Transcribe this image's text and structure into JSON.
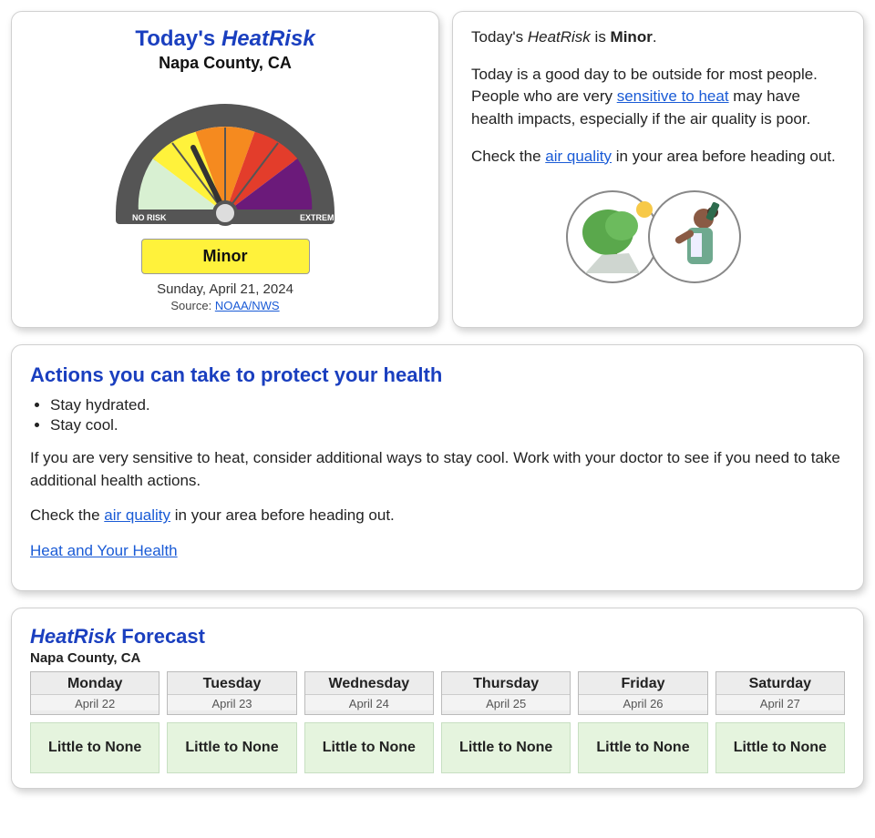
{
  "today_card": {
    "title_prefix": "Today's ",
    "title_brand": "HeatRisk",
    "location": "Napa County, CA",
    "gauge_labels": {
      "low": "NO RISK",
      "high": "EXTREME"
    },
    "risk_level": "Minor",
    "date": "Sunday, April 21, 2024",
    "source_prefix": "Source: ",
    "source_link": "NOAA/NWS"
  },
  "summary": {
    "line1_prefix": "Today's ",
    "line1_brand": "HeatRisk",
    "line1_mid": " is ",
    "line1_level": "Minor",
    "line1_suffix": ".",
    "line2_a": "Today is a good day to be outside for most people. People who are very ",
    "line2_link": "sensitive to heat",
    "line2_b": " may have health impacts, especially if the air quality is poor.",
    "line3_a": "Check the ",
    "line3_link": "air quality",
    "line3_b": " in your area before heading out."
  },
  "actions": {
    "heading": "Actions you can take to protect your health",
    "bullets": [
      "Stay hydrated.",
      "Stay cool."
    ],
    "para1": "If you are very sensitive to heat, consider additional ways to stay cool. Work with your doctor to see if you need to take additional health actions.",
    "para2_a": "Check the ",
    "para2_link": "air quality",
    "para2_b": " in your area before heading out.",
    "link_more": "Heat and Your Health"
  },
  "forecast": {
    "heading_brand": "HeatRisk",
    "heading_rest": " Forecast",
    "location": "Napa County, CA",
    "days": [
      {
        "dow": "Monday",
        "date": "April 22",
        "risk": "Little to None"
      },
      {
        "dow": "Tuesday",
        "date": "April 23",
        "risk": "Little to None"
      },
      {
        "dow": "Wednesday",
        "date": "April 24",
        "risk": "Little to None"
      },
      {
        "dow": "Thursday",
        "date": "April 25",
        "risk": "Little to None"
      },
      {
        "dow": "Friday",
        "date": "April 26",
        "risk": "Little to None"
      },
      {
        "dow": "Saturday",
        "date": "April 27",
        "risk": "Little to None"
      }
    ]
  },
  "colors": {
    "green": "#d8f0d2",
    "yellow": "#fff23b",
    "gold": "#ffd23b",
    "orange": "#f58a1f",
    "red": "#e33d2b",
    "purple": "#6b1a7a",
    "gauge_body": "#555"
  }
}
